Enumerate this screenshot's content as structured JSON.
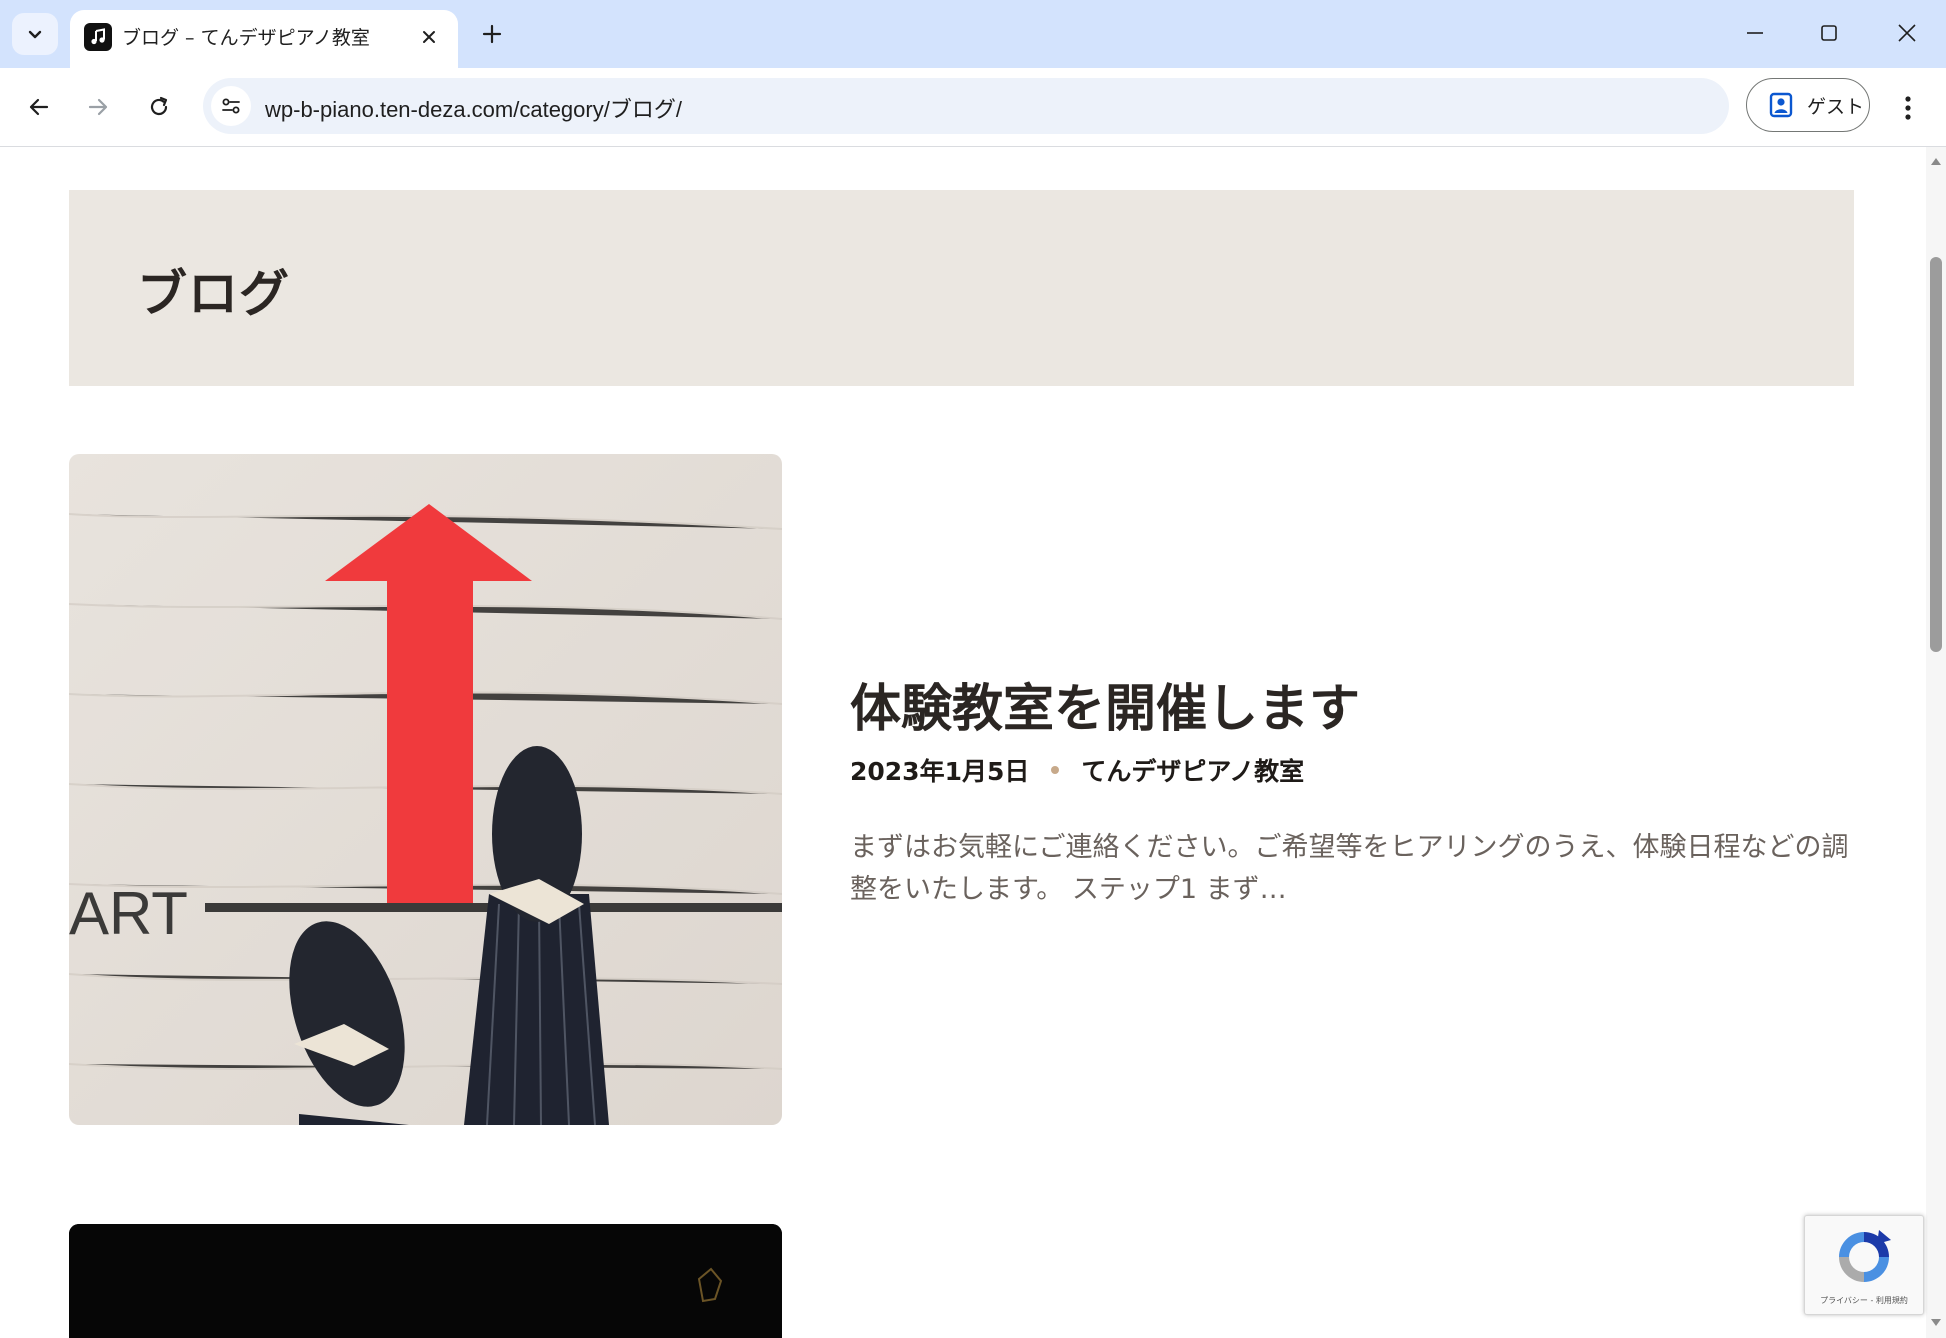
{
  "browser": {
    "tab": {
      "title": "ブログ – てんデザピアノ教室",
      "favicon": "music-note-icon"
    },
    "url": "wp-b-piano.ten-deza.com/category/ブログ/",
    "profile_label": "ゲスト",
    "colors": {
      "tabstrip": "#d3e3fd",
      "omnibox": "#edf2fa"
    }
  },
  "page": {
    "archive_title": "ブログ",
    "posts": [
      {
        "title": "体験教室を開催します",
        "date": "2023年1月5日",
        "author": "てんデザピアノ教室",
        "excerpt": "まずはお気軽にご連絡ください。ご希望等をヒアリングのうえ、体験日程などの調整をいたします。 ステップ1 まず…",
        "thumbnail_text": "ART"
      }
    ],
    "colors": {
      "hero_bg": "#ebe7e1",
      "heading": "#2b2623",
      "excerpt": "#6a625d",
      "meta_dot": "#c7a98a",
      "arrow_red": "#f03a3d"
    }
  },
  "recaptcha": {
    "footer_text": "プライバシー - 利用規約"
  }
}
